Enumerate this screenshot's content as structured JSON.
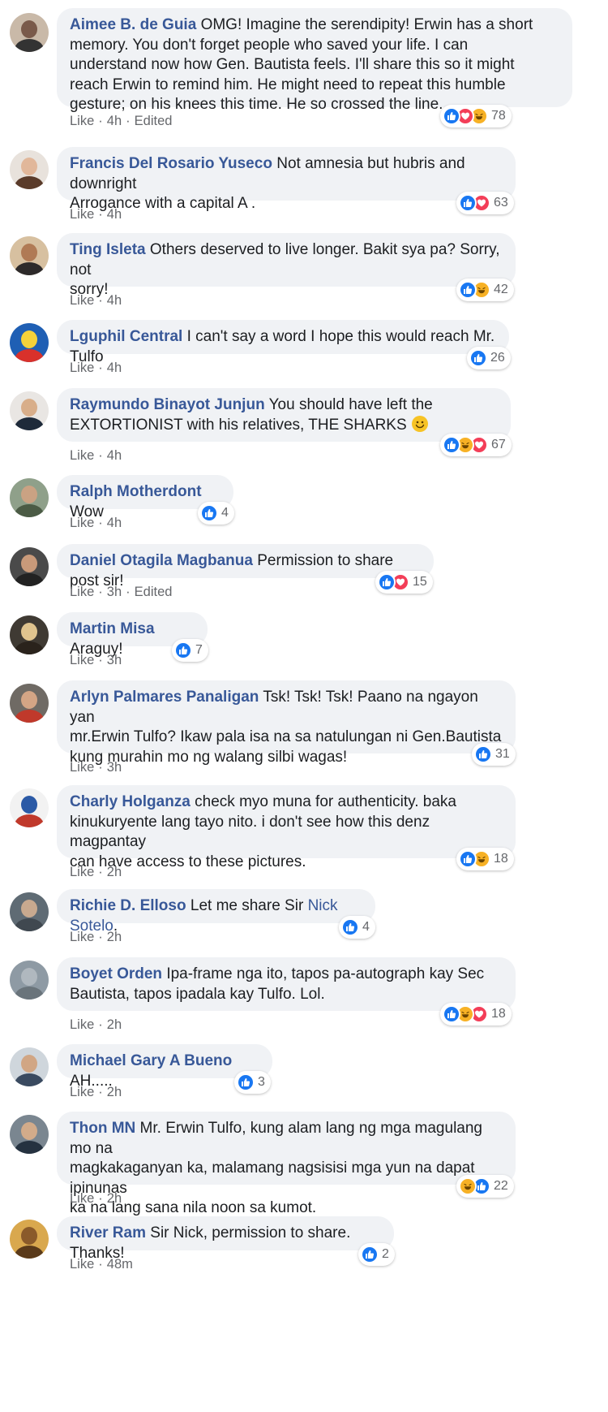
{
  "comments": [
    {
      "author": "Aimee B. de Guia",
      "lines": [
        "OMG! Imagine the serendipity! Erwin has a short",
        "memory. You don't forget people who saved your life. I can",
        "understand now how Gen. Bautista feels. I'll share this so it might",
        "reach Erwin to remind him. He might need to repeat this humble",
        "gesture; on his knees this time. He so crossed the line."
      ],
      "like": "Like",
      "time": "4h",
      "edited": "Edited",
      "reactions": [
        "like",
        "love",
        "haha"
      ],
      "count": "78"
    },
    {
      "author": "Francis Del Rosario Yuseco",
      "lines": [
        "Not amnesia but hubris and downright",
        "Arrogance with a capital A ."
      ],
      "like": "Like",
      "time": "4h",
      "reactions": [
        "like",
        "love"
      ],
      "count": "63"
    },
    {
      "author": "Ting Isleta",
      "lines": [
        "Others deserved to live longer. Bakit sya pa? Sorry, not",
        "sorry!"
      ],
      "like": "Like",
      "time": "4h",
      "reactions": [
        "like",
        "haha"
      ],
      "count": "42"
    },
    {
      "author": "Lguphil Central",
      "lines": [
        "I can't say a word I hope this would reach Mr. Tulfo"
      ],
      "like": "Like",
      "time": "4h",
      "reactions": [
        "like"
      ],
      "count": "26"
    },
    {
      "author": "Raymundo Binayot Junjun",
      "lines": [
        "You should have left the",
        "EXTORTIONIST with his relatives, THE SHARKS"
      ],
      "emoji": "smile",
      "like": "Like",
      "time": "4h",
      "reactions": [
        "like",
        "haha",
        "love"
      ],
      "count": "67"
    },
    {
      "author": "Ralph Motherdont",
      "lines": [
        "Wow"
      ],
      "like": "Like",
      "time": "4h",
      "reactions": [
        "like"
      ],
      "count": "4"
    },
    {
      "author": "Daniel Otagila Magbanua",
      "lines": [
        "Permission to share post sir!"
      ],
      "like": "Like",
      "time": "3h",
      "edited": "Edited",
      "reactions": [
        "like",
        "love"
      ],
      "count": "15"
    },
    {
      "author": "Martin Misa",
      "lines": [
        "Araguy!"
      ],
      "like": "Like",
      "time": "3h",
      "reactions": [
        "like"
      ],
      "count": "7"
    },
    {
      "author": "Arlyn Palmares Panaligan",
      "lines": [
        "Tsk! Tsk! Tsk! Paano na ngayon yan",
        "mr.Erwin Tulfo? Ikaw pala isa na sa natulungan ni Gen.Bautista",
        "kung murahin mo ng walang silbi wagas!"
      ],
      "like": "Like",
      "time": "3h",
      "reactions": [
        "like"
      ],
      "count": "31"
    },
    {
      "author": "Charly Holganza",
      "lines": [
        "check myo muna for authenticity. baka",
        "kinukuryente lang tayo nito. i don't see how this denz magpantay",
        "can have access to these pictures."
      ],
      "like": "Like",
      "time": "2h",
      "reactions": [
        "like",
        "haha"
      ],
      "count": "18"
    },
    {
      "author": "Richie D. Elloso",
      "lines": [
        "Let me share Sir"
      ],
      "mention": "Nick Sotelo",
      "after": ".",
      "like": "Like",
      "time": "2h",
      "reactions": [
        "like"
      ],
      "count": "4"
    },
    {
      "author": "Boyet Orden",
      "lines": [
        "Ipa-frame nga ito, tapos pa-autograph kay Sec",
        "Bautista, tapos ipadala kay Tulfo. Lol."
      ],
      "like": "Like",
      "time": "2h",
      "reactions": [
        "like",
        "haha",
        "love"
      ],
      "count": "18"
    },
    {
      "author": "Michael Gary A Bueno",
      "lines": [
        "AH....."
      ],
      "like": "Like",
      "time": "2h",
      "reactions": [
        "like"
      ],
      "count": "3"
    },
    {
      "author": "Thon MN",
      "lines": [
        "Mr. Erwin Tulfo, kung alam lang ng mga magulang mo na",
        "magkakaganyan ka, malamang nagsisisi mga yun na dapat ipinunas",
        "ka na lang sana nila noon sa kumot."
      ],
      "like": "Like",
      "time": "2h",
      "reactions": [
        "haha",
        "like"
      ],
      "count": "22"
    },
    {
      "author": "River Ram",
      "lines": [
        "Sir Nick, permission to share. Thanks!"
      ],
      "like": "Like",
      "time": "48m",
      "reactions": [
        "like"
      ],
      "count": "2"
    }
  ],
  "separator": "·",
  "colors": {
    "author": "#385898",
    "bubble": "#f0f2f5",
    "meta": "#65676b",
    "like": "#1877f2",
    "love": "#f33e58",
    "haha": "#f7b125"
  }
}
